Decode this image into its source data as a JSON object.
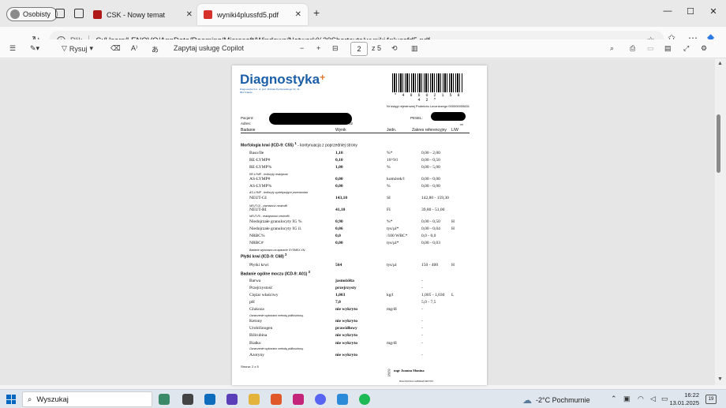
{
  "browser": {
    "profile": {
      "label": "Osobisty",
      "icon": "profile-icon"
    },
    "tabs": [
      {
        "title": "CSK - Nowy temat",
        "icon": "csk-favicon",
        "active": false
      },
      {
        "title": "wyniki4plussfd5.pdf",
        "icon": "pdf-favicon",
        "active": true
      }
    ],
    "new_tab": "+",
    "address": {
      "scheme_label": "Plik",
      "url": "C:/Users/LENOVO/AppData/Roaming/Microsoft/Windows/Network%20Shortcuts/wyniki4plussfd5.pdf"
    }
  },
  "pdf_toolbar": {
    "draw_label": "Rysuj",
    "copilot_label": "Zapytaj usługę Copilot",
    "page_current": "2",
    "page_total": "z 5"
  },
  "document": {
    "logo": "Diagnostyka",
    "logo_plus": "+",
    "logo_sub": "Diagnostyka S.A. ul. prof. Michała Życzkowskiego 16, 31-864 Kraków",
    "barcode_number": "* 4 9 6 0 2 1 5 8 4 2 *",
    "registry": "Nr księgi rejestrowej Podmiotu Leczniczego 000000005631",
    "labels": {
      "patient": "Pacjent:",
      "address": "Adres:",
      "pesel": "PESEL:",
      "redacted_suffix": "02"
    },
    "columns": {
      "test": "Badanie",
      "result": "Wynik",
      "unit": "Jedn.",
      "range": "Zakres referencyjny",
      "flag": "L/W",
      "flag_mark": "**"
    },
    "section1": {
      "title": "Morfologia krwi (ICD-9: C55)",
      "sup": "1",
      "suffix": " - kontynuacja z poprzedniej strony"
    },
    "rows1": [
      {
        "name": "Baso/Ile",
        "value": "1,10",
        "unit": "%*",
        "range": "0,00 - 2,00",
        "flag": ""
      },
      {
        "name": "RE-LYMP#",
        "value": "0,10",
        "unit": "10^9/l",
        "range": "0,00 - 0,50",
        "flag": ""
      },
      {
        "name": "RE-LYMP%",
        "value": "1,00",
        "unit": "%",
        "range": "0,00 - 5,00",
        "flag": ""
      },
      {
        "name": "AS-LYMP#",
        "value": "0,00",
        "unit": "komórek/l",
        "range": "0,00 - 0,00",
        "flag": ""
      },
      {
        "name": "AS-LYMP%",
        "value": "0,00",
        "unit": "%",
        "range": "0,00 - 0,00",
        "flag": ""
      },
      {
        "name": "NEUT-GI",
        "value": "143,10",
        "unit": "SI",
        "range": "142,80 - 159,30",
        "flag": ""
      },
      {
        "name": "NEUT-RI",
        "value": "41,10",
        "unit": "FI",
        "range": "39,80 - 51,00",
        "flag": ""
      },
      {
        "name": "Niedojrzałe granulocyty IG %",
        "value": "0,90",
        "unit": "%*",
        "range": "0,00 - 0,50",
        "flag": "H"
      },
      {
        "name": "Niedojrzałe granulocyty IG il.",
        "value": "0,06",
        "unit": "tys/µl*",
        "range": "0,00 - 0,04",
        "flag": "H"
      },
      {
        "name": "NRBC%",
        "value": "0,0",
        "unit": "/100 WBC*",
        "range": "0,0 - 0,0",
        "flag": ""
      },
      {
        "name": "NRBC#",
        "value": "0,00",
        "unit": "tys/µl*",
        "range": "0,00 - 0,03",
        "flag": ""
      }
    ],
    "notes1": [
      "RE-LYMP - limfocyty reaktywne",
      "AS-LYMP - limfocyty syntetyzujące przeciwciała",
      "NEUT-GI - ziarnistość neutrofili",
      "NEUT-RI - reaktywność neutrofili",
      "Badanie wykonano na aparacie SYSMEX XN."
    ],
    "section2": {
      "title": "Płytki krwi (ICD-9: C68)",
      "sup": "2"
    },
    "rows2": [
      {
        "name": "Płytki krwi",
        "value": "564",
        "unit": "tys/µl",
        "range": "150 - 400",
        "flag": "H"
      }
    ],
    "section3": {
      "title": "Badanie ogólne moczu (ICD-9: A01)",
      "sup": "3"
    },
    "rows3": [
      {
        "name": "Barwa",
        "value": "jasnożółta",
        "unit": "",
        "range": "-",
        "flag": ""
      },
      {
        "name": "Przejrzystość",
        "value": "przejrzysty",
        "unit": "",
        "range": "-",
        "flag": ""
      },
      {
        "name": "Ciężar właściwy",
        "value": "1,003",
        "unit": "kg/l",
        "range": "1,005 - 1,030",
        "flag": "L"
      },
      {
        "name": "pH",
        "value": "7,0",
        "unit": "",
        "range": "5,0 - 7,5",
        "flag": ""
      },
      {
        "name": "Glukoza",
        "value": "nie wykryto",
        "unit": "mg/dl",
        "range": "-",
        "flag": ""
      },
      {
        "name": "Ketony",
        "value": "nie wykryto",
        "unit": "",
        "range": "-",
        "flag": ""
      },
      {
        "name": "Urobilinogen",
        "value": "prawidłowy",
        "unit": "",
        "range": "-",
        "flag": ""
      },
      {
        "name": "Bilirubina",
        "value": "nie wykryto",
        "unit": "",
        "range": "-",
        "flag": ""
      },
      {
        "name": "Białko",
        "value": "nie wykryto",
        "unit": "mg/dl",
        "range": "-",
        "flag": ""
      },
      {
        "name": "Azotyny",
        "value": "nie wykryto",
        "unit": "",
        "range": "-",
        "flag": ""
      }
    ],
    "notes3": [
      "Oznaczenie wykonano metodą półilościową.",
      "Oznaczenie wykonano metodą półilościową."
    ],
    "page_footer": "Strona: 2 z 5",
    "signature": "mgr Joanna Słonina",
    "signature_title": "DIAGNOSTA LABORATORYJNY",
    "signature_id": "18959"
  },
  "taskbar": {
    "search_label": "Wyszukaj",
    "weather": "-2°C  Pochmurnie",
    "weather_badge": "1",
    "time": "16:22",
    "date": "13.01.2025",
    "notifications": "19"
  }
}
